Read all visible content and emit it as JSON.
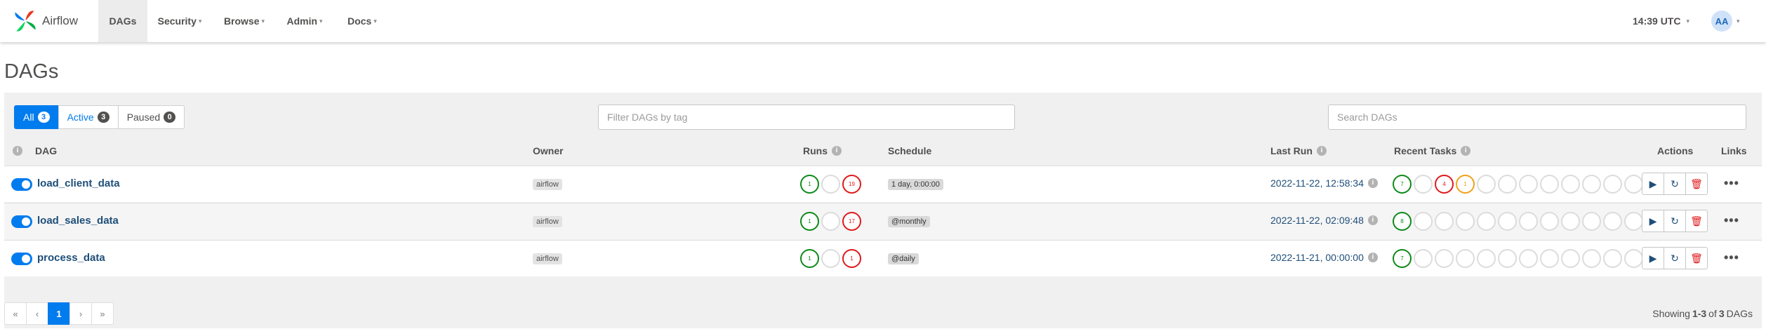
{
  "app": {
    "brand": "Airflow",
    "nav": [
      {
        "label": "DAGs",
        "active": true,
        "has_caret": false
      },
      {
        "label": "Security",
        "active": false,
        "has_caret": true
      },
      {
        "label": "Browse",
        "active": false,
        "has_caret": true
      },
      {
        "label": "Admin",
        "active": false,
        "has_caret": true
      },
      {
        "label": "Docs",
        "active": false,
        "has_caret": true
      }
    ],
    "clock": "14:39 UTC",
    "user_initials": "AA",
    "accent_color": "#017cee"
  },
  "page": {
    "title": "DAGs",
    "filters": [
      {
        "label": "All",
        "count": "3",
        "active": true
      },
      {
        "label": "Active",
        "count": "3",
        "active": false
      },
      {
        "label": "Paused",
        "count": "0",
        "active": false
      }
    ],
    "tag_filter_placeholder": "Filter DAGs by tag",
    "search_placeholder": "Search DAGs"
  },
  "table": {
    "columns": {
      "dag": "DAG",
      "owner": "Owner",
      "runs": "Runs",
      "schedule": "Schedule",
      "last_run": "Last Run",
      "recent_tasks": "Recent Tasks",
      "actions": "Actions",
      "links": "Links"
    },
    "rows": [
      {
        "dag_id": "load_client_data",
        "active": true,
        "owner": "airflow",
        "runs": [
          {
            "state": "success",
            "count": "1"
          },
          {
            "state": "empty",
            "count": ""
          },
          {
            "state": "failed",
            "count": "19"
          }
        ],
        "schedule": "1 day, 0:00:00",
        "last_run": "2022-11-22, 12:58:34",
        "recent_tasks": [
          {
            "state": "success",
            "count": "7"
          },
          {
            "state": "empty",
            "count": ""
          },
          {
            "state": "failed",
            "count": "4"
          },
          {
            "state": "retry",
            "count": "1"
          },
          {
            "state": "empty",
            "count": ""
          },
          {
            "state": "empty",
            "count": ""
          },
          {
            "state": "empty",
            "count": ""
          },
          {
            "state": "empty",
            "count": ""
          },
          {
            "state": "empty",
            "count": ""
          },
          {
            "state": "empty",
            "count": ""
          },
          {
            "state": "empty",
            "count": ""
          },
          {
            "state": "empty",
            "count": ""
          }
        ]
      },
      {
        "dag_id": "load_sales_data",
        "active": true,
        "owner": "airflow",
        "runs": [
          {
            "state": "success",
            "count": "1"
          },
          {
            "state": "empty",
            "count": ""
          },
          {
            "state": "failed",
            "count": "17"
          }
        ],
        "schedule": "@monthly",
        "last_run": "2022-11-22, 02:09:48",
        "recent_tasks": [
          {
            "state": "success",
            "count": "8"
          },
          {
            "state": "empty",
            "count": ""
          },
          {
            "state": "empty",
            "count": ""
          },
          {
            "state": "empty",
            "count": ""
          },
          {
            "state": "empty",
            "count": ""
          },
          {
            "state": "empty",
            "count": ""
          },
          {
            "state": "empty",
            "count": ""
          },
          {
            "state": "empty",
            "count": ""
          },
          {
            "state": "empty",
            "count": ""
          },
          {
            "state": "empty",
            "count": ""
          },
          {
            "state": "empty",
            "count": ""
          },
          {
            "state": "empty",
            "count": ""
          }
        ]
      },
      {
        "dag_id": "process_data",
        "active": true,
        "owner": "airflow",
        "runs": [
          {
            "state": "success",
            "count": "1"
          },
          {
            "state": "empty",
            "count": ""
          },
          {
            "state": "failed",
            "count": "1"
          }
        ],
        "schedule": "@daily",
        "last_run": "2022-11-21, 00:00:00",
        "recent_tasks": [
          {
            "state": "success",
            "count": "7"
          },
          {
            "state": "empty",
            "count": ""
          },
          {
            "state": "empty",
            "count": ""
          },
          {
            "state": "empty",
            "count": ""
          },
          {
            "state": "empty",
            "count": ""
          },
          {
            "state": "empty",
            "count": ""
          },
          {
            "state": "empty",
            "count": ""
          },
          {
            "state": "empty",
            "count": ""
          },
          {
            "state": "empty",
            "count": ""
          },
          {
            "state": "empty",
            "count": ""
          },
          {
            "state": "empty",
            "count": ""
          },
          {
            "state": "empty",
            "count": ""
          }
        ]
      }
    ],
    "state_colors": {
      "success": "#0d8a19",
      "failed": "#e0191b",
      "retry": "#f0a11c"
    }
  },
  "pagination": {
    "first": "«",
    "prev": "‹",
    "current": "1",
    "next": "›",
    "last": "»",
    "summary": {
      "prefix": "Showing",
      "range": "1-3",
      "of": "of",
      "total": "3",
      "suffix": "DAGs"
    }
  },
  "icons": {
    "info": "i",
    "trigger": "▶",
    "refresh": "↻",
    "delete": "🗑",
    "more": "•••",
    "caret": "▾"
  }
}
